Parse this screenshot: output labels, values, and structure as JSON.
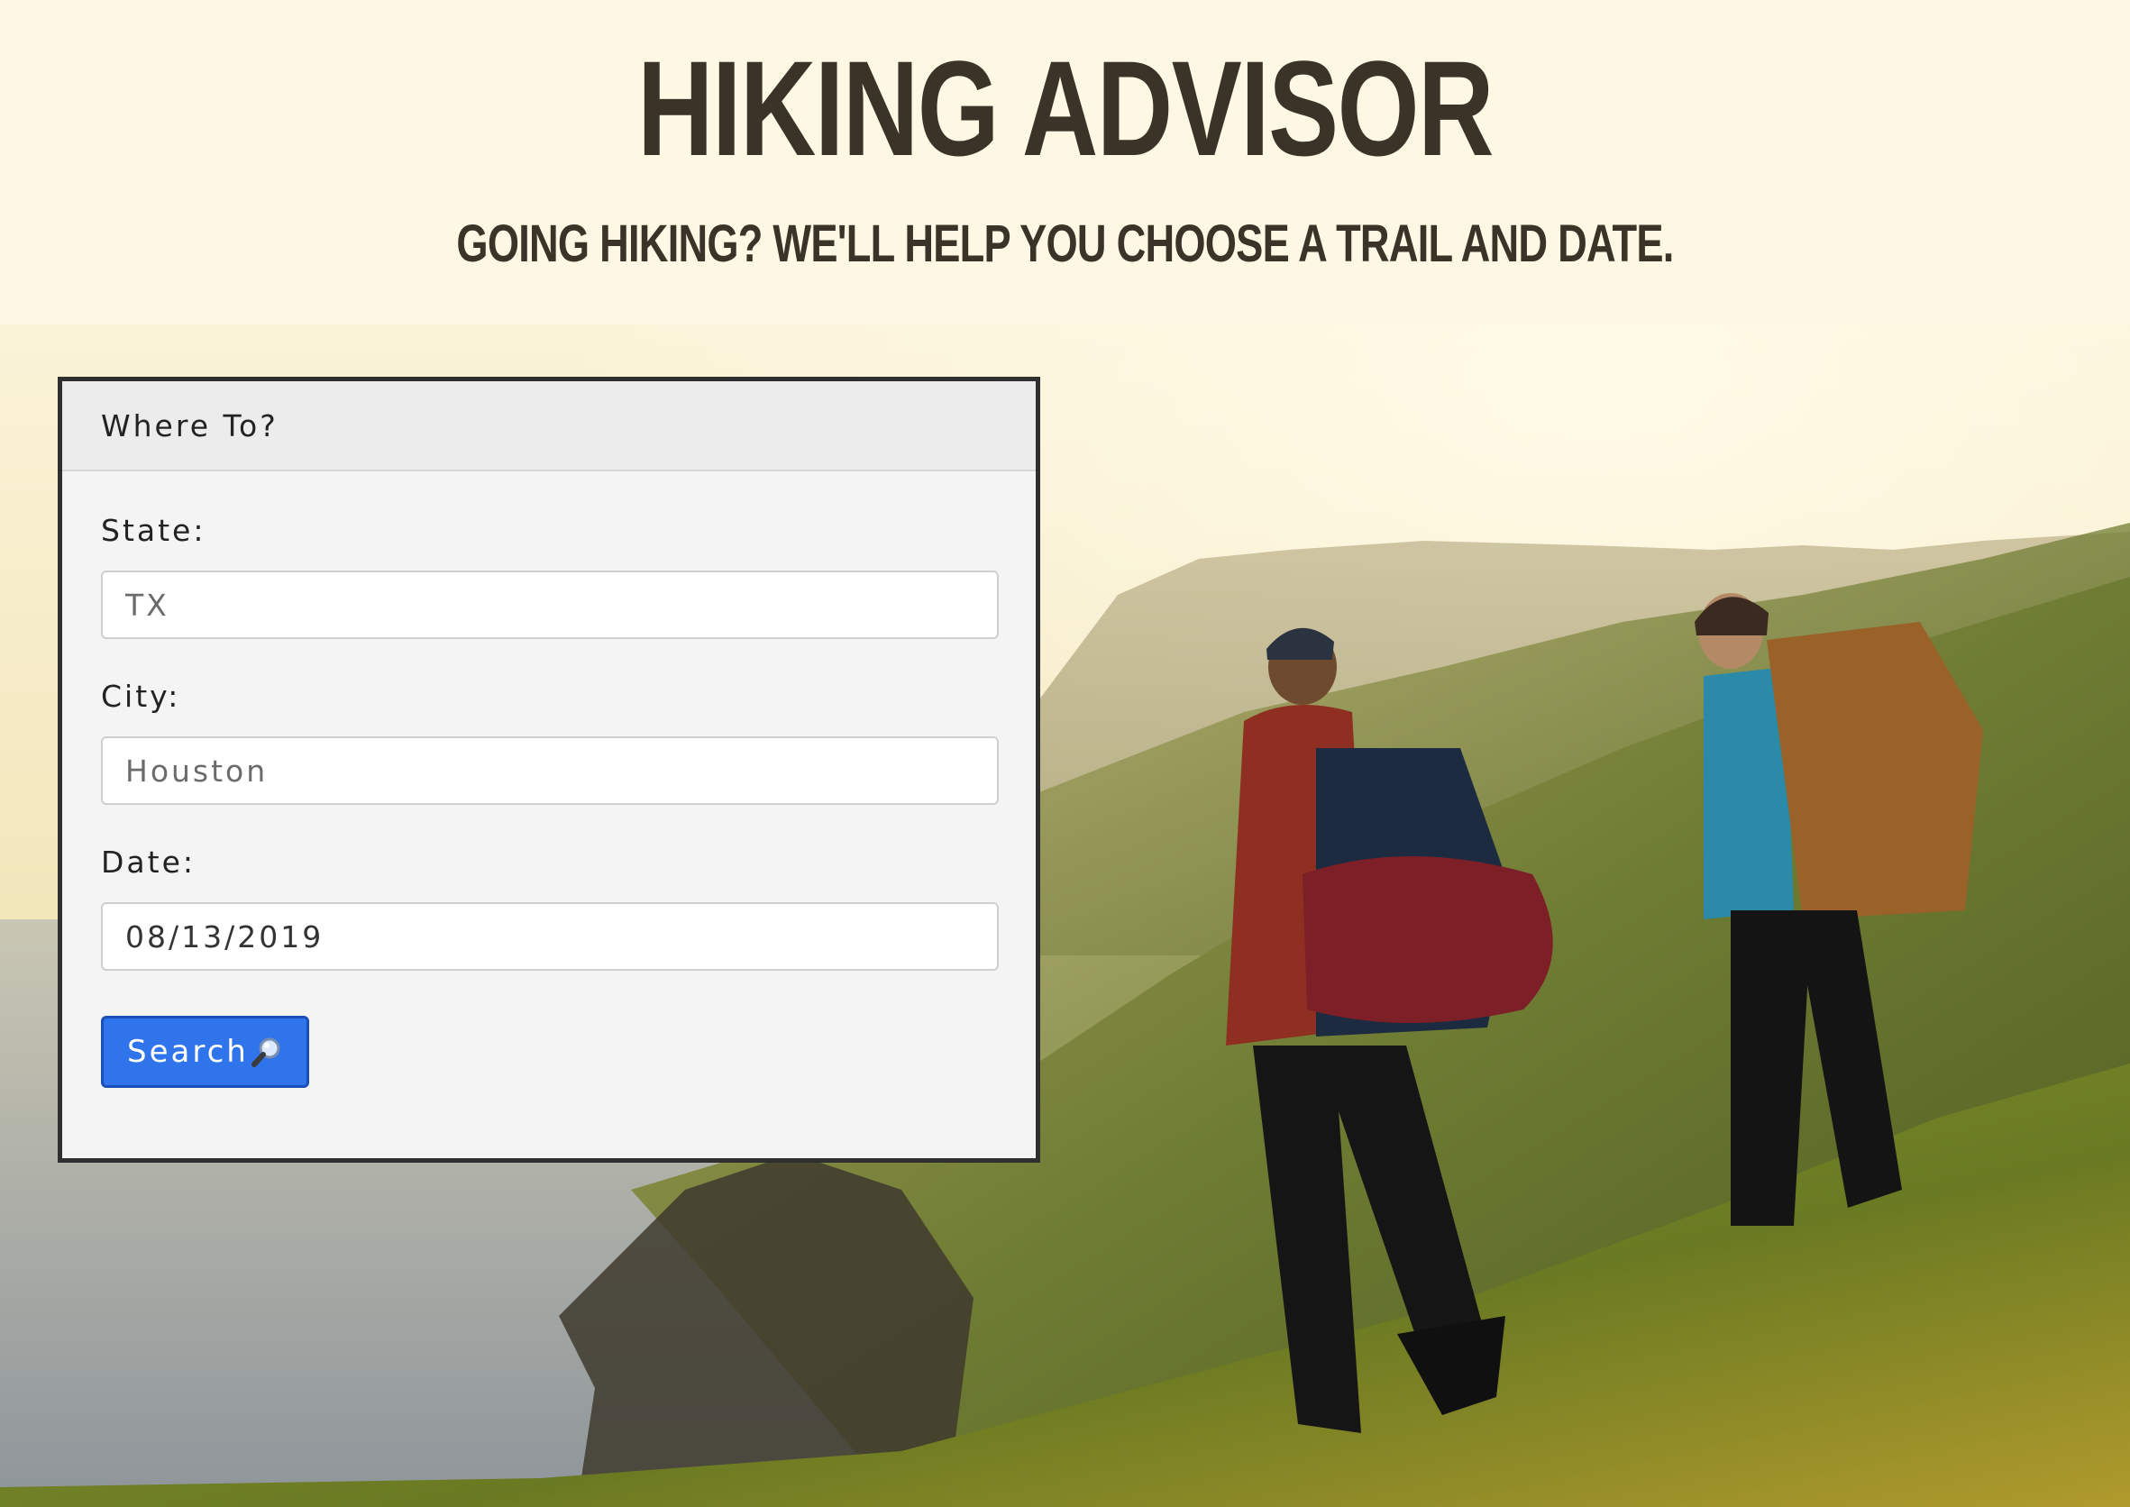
{
  "header": {
    "title": "HIKING ADVISOR",
    "subtitle": "GOING HIKING? WE'LL HELP YOU CHOOSE A TRAIL AND DATE."
  },
  "form": {
    "heading": "Where To?",
    "state": {
      "label": "State:",
      "placeholder": "TX"
    },
    "city": {
      "label": "City:",
      "placeholder": "Houston"
    },
    "date": {
      "label": "Date:",
      "value": "08/13/2019"
    },
    "search_label": "Search",
    "search_icon": "magnifying-glass-icon"
  },
  "colors": {
    "background": "#fdf8e3",
    "heading_text": "#3b3228",
    "button": "#2f74ea"
  }
}
